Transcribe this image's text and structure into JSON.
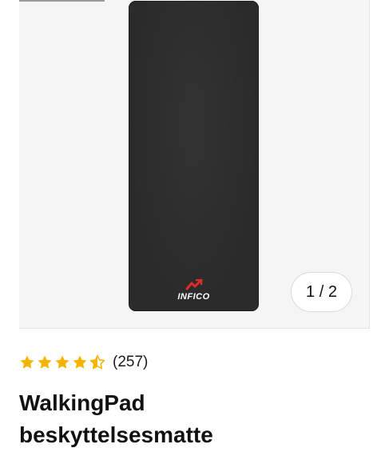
{
  "gallery": {
    "counter": "1 / 2",
    "product_image": {
      "brand_text": "INFICO",
      "mat_color": "#2b2b2b",
      "brand_accent_color": "#e02b2b"
    }
  },
  "rating": {
    "stars": 4.5,
    "star_color": "#f4b400",
    "count": "(257)"
  },
  "product": {
    "title_line1": "WalkingPad",
    "title_line2": "beskyttelsesmatte"
  }
}
